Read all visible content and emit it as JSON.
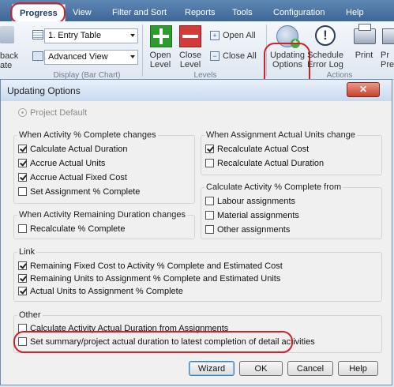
{
  "ribbon": {
    "tabs": [
      "Progress",
      "View",
      "Filter and Sort",
      "Reports",
      "Tools",
      "Configuration",
      "Help"
    ],
    "cut_label_1": "back",
    "cut_label_2": "ate",
    "table_combo": "1. Entry Table",
    "view_combo": "Advanced View",
    "display_group": "Display (Bar Chart)",
    "levels_group": "Levels",
    "actions_group": "Actions",
    "open_level": "Open\nLevel",
    "close_level": "Close\nLevel",
    "open_all": "Open All",
    "close_all": "Close All",
    "updating_options": "Updating\nOptions",
    "schedule_error_log": "Schedule\nError Log",
    "print": "Print",
    "print_preview_cut": "Pr\nPre"
  },
  "dialog": {
    "title": "Updating Options",
    "close": "✕",
    "project_default": "Project Default",
    "groups": {
      "activity_pct": {
        "title": "When Activity % Complete changes",
        "items": [
          {
            "label": "Calculate Actual Duration",
            "checked": true
          },
          {
            "label": "Accrue Actual Units",
            "checked": true
          },
          {
            "label": "Accrue Actual Fixed Cost",
            "checked": true
          },
          {
            "label": "Set Assignment % Complete",
            "checked": false
          }
        ]
      },
      "assignment_units": {
        "title": "When Assignment Actual Units change",
        "items": [
          {
            "label": "Recalculate Actual Cost",
            "checked": true
          },
          {
            "label": "Recalculate Actual Duration",
            "checked": false
          }
        ]
      },
      "calc_activity_pct": {
        "title": "Calculate Activity % Complete from",
        "items": [
          {
            "label": "Labour assignments",
            "checked": false
          },
          {
            "label": "Material assignments",
            "checked": false
          },
          {
            "label": "Other assignments",
            "checked": false
          }
        ]
      },
      "remaining_duration": {
        "title": "When Activity Remaining Duration changes",
        "items": [
          {
            "label": "Recalculate % Complete",
            "checked": false
          }
        ]
      },
      "link": {
        "title": "Link",
        "items": [
          {
            "label": "Remaining Fixed Cost to Activity % Complete and Estimated Cost",
            "checked": true
          },
          {
            "label": "Remaining Units to Assignment % Complete and Estimated Units",
            "checked": true
          },
          {
            "label": "Actual Units to Assignment % Complete",
            "checked": true
          }
        ]
      },
      "other": {
        "title": "Other",
        "items": [
          {
            "label": "Calculate Activity Actual Duration from Assignments",
            "checked": false
          },
          {
            "label": "Set summary/project actual duration to latest completion of detail activities",
            "checked": false
          }
        ]
      }
    },
    "buttons": {
      "wizard": "Wizard",
      "ok": "OK",
      "cancel": "Cancel",
      "help": "Help"
    }
  },
  "colors": {
    "annotation": "#d0202a",
    "ribbon_tab_bar": "#4a74a6",
    "green_plus": "#2e9b2e",
    "red_minus": "#d33a3a"
  }
}
